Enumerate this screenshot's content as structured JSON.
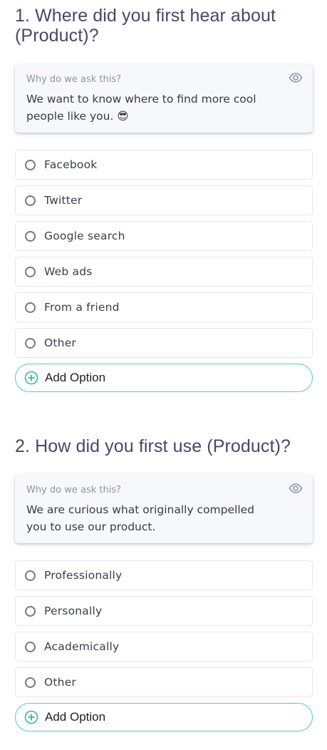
{
  "colors": {
    "title": "#4a4668",
    "card_bg": "#f6f8fc",
    "accent_green": "#4fd1a8",
    "option_border": "#e4e6ec"
  },
  "questions": [
    {
      "title": "1. Where did you first hear about (Product)?",
      "why_label": "Why do we ask this?",
      "why_text": "We want to know where to find more cool people like you. 😎",
      "options": [
        "Facebook",
        "Twitter",
        "Google search",
        "Web ads",
        "From a friend",
        "Other"
      ],
      "add_option_label": "Add Option"
    },
    {
      "title": "2. How did you first use (Product)?",
      "why_label": "Why do we ask this?",
      "why_text": "We are curious what originally compelled you to use our product.",
      "options": [
        "Professionally",
        "Personally",
        "Academically",
        "Other"
      ],
      "add_option_label": "Add Option"
    }
  ],
  "icons": {
    "visibility": "eye-icon",
    "radio": "radio-circle",
    "add": "plus-circle-icon"
  }
}
